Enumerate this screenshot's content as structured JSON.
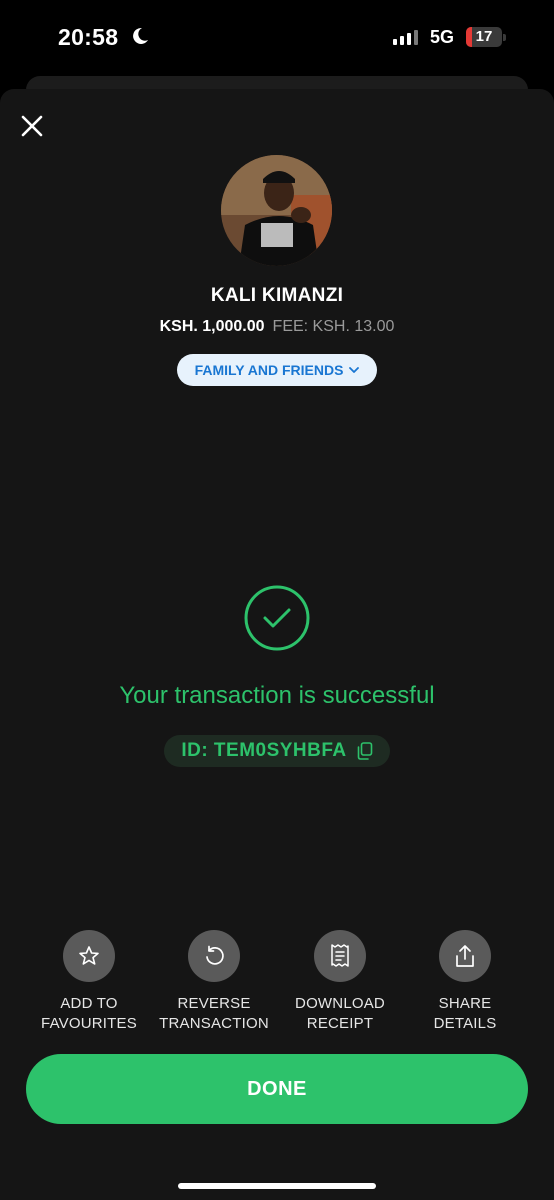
{
  "status_bar": {
    "time": "20:58",
    "network": "5G",
    "battery": "17"
  },
  "recipient": {
    "name": "KALI KIMANZI",
    "amount": "KSH. 1,000.00",
    "fee": "FEE: KSH. 13.00",
    "category": "FAMILY AND FRIENDS"
  },
  "result": {
    "message": "Your transaction is successful",
    "transaction_id": "ID: TEM0SYHBFA"
  },
  "actions": {
    "favourite": {
      "line1": "ADD TO",
      "line2": "FAVOURITES",
      "icon": "star-icon"
    },
    "reverse": {
      "line1": "REVERSE",
      "line2": "TRANSACTION",
      "icon": "undo-icon"
    },
    "receipt": {
      "line1": "DOWNLOAD",
      "line2": "RECEIPT",
      "icon": "receipt-icon"
    },
    "share": {
      "line1": "SHARE",
      "line2": "DETAILS",
      "icon": "share-icon"
    }
  },
  "done_label": "DONE",
  "colors": {
    "accent": "#2dc26b",
    "background": "#151515",
    "category_bg": "#e7f2fc",
    "category_text": "#1976d2"
  }
}
